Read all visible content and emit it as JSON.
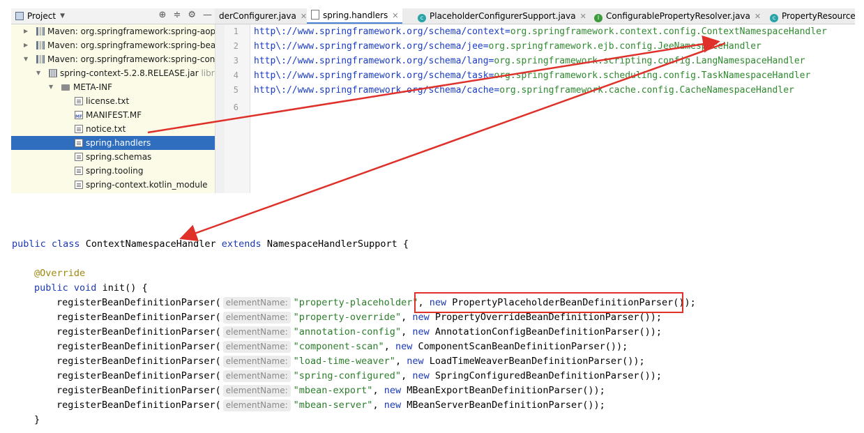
{
  "project_panel": {
    "title": "Project",
    "caret": "▼",
    "tools": [
      "⊕",
      "≑",
      "⚙",
      "—"
    ],
    "tree": [
      {
        "label": "Maven: org.springframework:spring-aop",
        "suffix": "",
        "icon": "library-icon",
        "expanded": false
      },
      {
        "label": "Maven: org.springframework:spring-bear",
        "suffix": "",
        "icon": "library-icon",
        "expanded": false
      },
      {
        "label": "Maven: org.springframework:spring-cont",
        "suffix": "",
        "icon": "library-icon",
        "expanded": true
      },
      {
        "label": "spring-context-5.2.8.RELEASE.jar",
        "suffix": "librai",
        "icon": "jar-icon",
        "expanded": true
      },
      {
        "label": "META-INF",
        "suffix": "",
        "icon": "folder-icon",
        "expanded": true
      },
      {
        "label": "license.txt",
        "suffix": "",
        "icon": "file-icon"
      },
      {
        "label": "MANIFEST.MF",
        "suffix": "",
        "icon": "manifest-icon"
      },
      {
        "label": "notice.txt",
        "suffix": "",
        "icon": "file-icon"
      },
      {
        "label": "spring.handlers",
        "suffix": "",
        "icon": "file-icon",
        "selected": true
      },
      {
        "label": "spring.schemas",
        "suffix": "",
        "icon": "file-icon"
      },
      {
        "label": "spring.tooling",
        "suffix": "",
        "icon": "file-icon"
      },
      {
        "label": "spring-context.kotlin_module",
        "suffix": "",
        "icon": "file-icon"
      }
    ]
  },
  "tabs": [
    {
      "label": "derConfigurer.java",
      "badge": ""
    },
    {
      "label": "spring.handlers",
      "badge": "file"
    },
    {
      "label": "PlaceholderConfigurerSupport.java",
      "badge": "C"
    },
    {
      "label": "ConfigurablePropertyResolver.java",
      "badge": "I"
    },
    {
      "label": "PropertyResourceCo",
      "badge": "C"
    }
  ],
  "editor": {
    "line_numbers": [
      "1",
      "2",
      "3",
      "4",
      "5",
      "6"
    ],
    "lines": [
      {
        "key": "http\\://www.springframework.org/schema/context=",
        "value": "org.springframework.context.config.ContextNamespaceHandler"
      },
      {
        "key": "http\\://www.springframework.org/schema/jee=",
        "value": "org.springframework.ejb.config.JeeNamespaceHandler"
      },
      {
        "key": "http\\://www.springframework.org/schema/lang=",
        "value": "org.springframework.scripting.config.LangNamespaceHandler"
      },
      {
        "key": "http\\://www.springframework.org/schema/task=",
        "value": "org.springframework.scheduling.config.TaskNamespaceHandler"
      },
      {
        "key": "http\\://www.springframework.org/schema/cache=",
        "value": "org.springframework.cache.config.CacheNamespaceHandler"
      },
      {
        "key": "",
        "value": ""
      }
    ]
  },
  "code": {
    "class_decl": {
      "kw1": "public",
      "kw2": "class",
      "name": "ContextNamespaceHandler",
      "kw3": "extends",
      "parent": "NamespaceHandlerSupport",
      "brace": "{"
    },
    "annotation": "@Override",
    "method_decl": {
      "kw1": "public",
      "kw2": "void",
      "rest": "init() {"
    },
    "call_name": "registerBeanDefinitionParser(",
    "hint": "elementName:",
    "calls": [
      {
        "arg": "\"property-placeholder\"",
        "parser": "PropertyPlaceholderBeanDefinitionParser());"
      },
      {
        "arg": "\"property-override\"",
        "parser": "PropertyOverrideBeanDefinitionParser());"
      },
      {
        "arg": "\"annotation-config\"",
        "parser": "AnnotationConfigBeanDefinitionParser());"
      },
      {
        "arg": "\"component-scan\"",
        "parser": "ComponentScanBeanDefinitionParser());"
      },
      {
        "arg": "\"load-time-weaver\"",
        "parser": "LoadTimeWeaverBeanDefinitionParser());"
      },
      {
        "arg": "\"spring-configured\"",
        "parser": "SpringConfiguredBeanDefinitionParser());"
      },
      {
        "arg": "\"mbean-export\"",
        "parser": "MBeanExportBeanDefinitionParser());"
      },
      {
        "arg": "\"mbean-server\"",
        "parser": "MBeanServerBeanDefinitionParser());"
      }
    ],
    "new_kw": "new",
    "comma": ",",
    "close_brace": "}"
  },
  "colors": {
    "arrow": "#e0302a",
    "selection": "#2f6dbf"
  }
}
